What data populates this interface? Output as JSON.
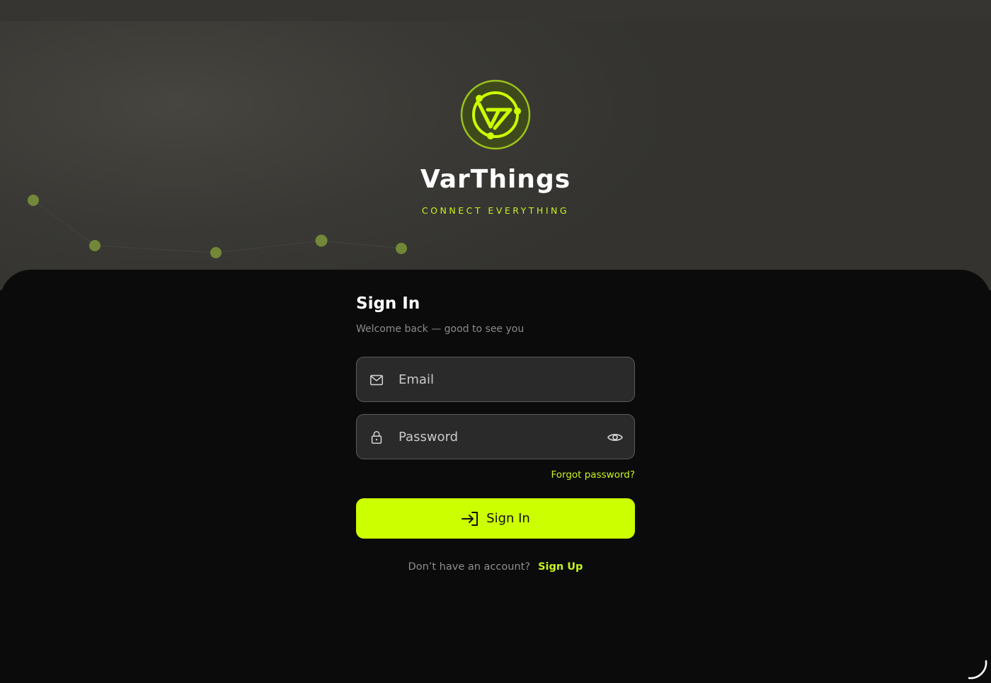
{
  "brand": {
    "name": "VarThings",
    "tagline": "CONNECT EVERYTHING",
    "logo_icon": "varthings-logo-icon",
    "accent_color": "#ccff00"
  },
  "signin": {
    "title": "Sign In",
    "subtitle": "Welcome back — good to see you",
    "email": {
      "placeholder": "Email",
      "value": "",
      "icon": "mail-icon"
    },
    "password": {
      "placeholder": "Password",
      "value": "",
      "icon": "lock-icon",
      "toggle_icon": "eye-icon"
    },
    "forgot_label": "Forgot password?",
    "submit_label": "Sign In",
    "submit_icon": "login-arrow-icon",
    "no_account_text": "Don’t have an account?",
    "signup_label": "Sign Up"
  },
  "colors": {
    "background": "#0b0b0b",
    "hero": "#3a3935",
    "field_bg": "#2a2a2a",
    "muted_text": "#8a8a8a"
  }
}
